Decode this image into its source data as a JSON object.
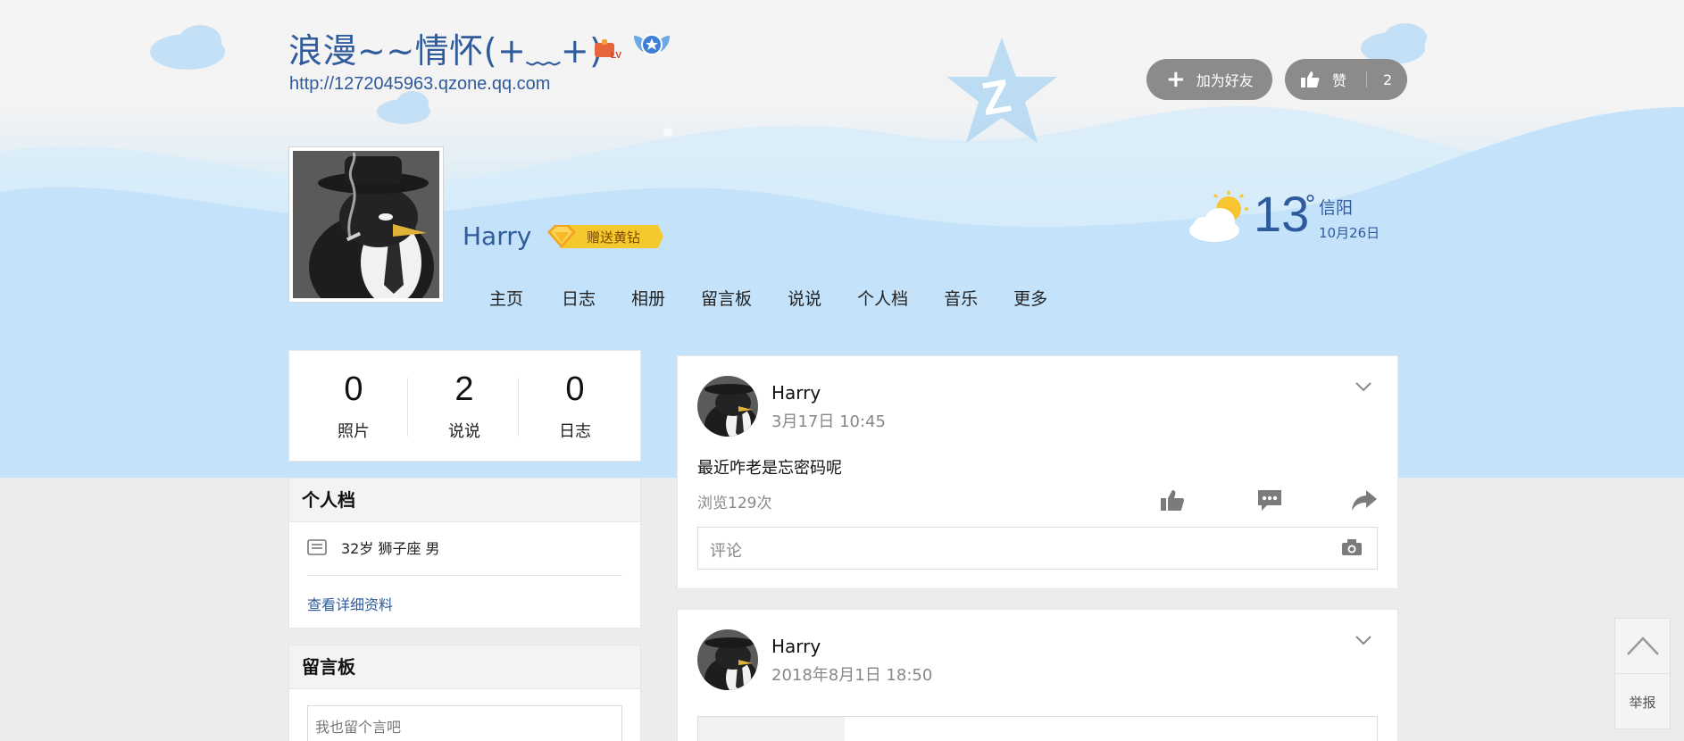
{
  "header": {
    "space_title": "浪漫~~情怀(+﹏+)",
    "space_url": "http://1272045963.qzone.qq.com",
    "add_friend_label": "加为好友",
    "like_label": "赞",
    "like_count": "2"
  },
  "owner": {
    "name": "Harry",
    "gift_badge_label": "赠送黄钻"
  },
  "weather": {
    "temperature": "13",
    "degree": "°",
    "city": "信阳",
    "date": "10月26日"
  },
  "nav": {
    "items": [
      "主页",
      "日志",
      "相册",
      "留言板",
      "说说",
      "个人档",
      "音乐",
      "更多"
    ]
  },
  "stats": [
    {
      "value": "0",
      "label": "照片"
    },
    {
      "value": "2",
      "label": "说说"
    },
    {
      "value": "0",
      "label": "日志"
    }
  ],
  "profile": {
    "title": "个人档",
    "summary": "32岁  狮子座 男",
    "detail_link": "查看详细资料"
  },
  "message_board": {
    "title": "留言板",
    "placeholder": "我也留个言吧"
  },
  "feed": [
    {
      "author": "Harry",
      "time": "3月17日 10:45",
      "text": "最近咋老是忘密码呢",
      "views": "浏览129次",
      "comment_placeholder": "评论"
    },
    {
      "author": "Harry",
      "time": "2018年8月1日 18:50"
    }
  ],
  "side_tools": {
    "report_label": "举报"
  },
  "colors": {
    "title_blue": "#2f5b9c",
    "header_button_gray": "#8b8b8b",
    "sky_blue": "#c0e2fb",
    "icon_gray": "#7b7b7b"
  }
}
